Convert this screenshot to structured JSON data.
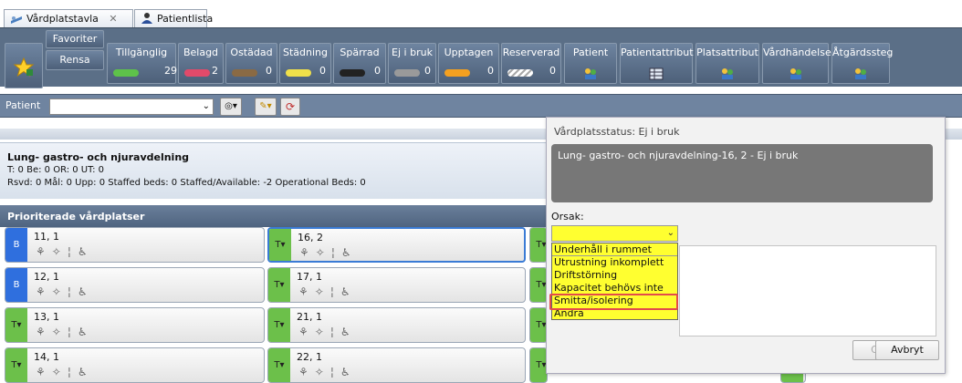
{
  "tabs": [
    {
      "label": "Vårdplatstavla"
    },
    {
      "label": "Patientlista"
    }
  ],
  "toolbar": {
    "favorites_label": "Favoriter",
    "clear_label": "Rensa",
    "status_buttons": [
      {
        "label": "Tillgänglig",
        "count": "29",
        "color": "#5ec24a"
      },
      {
        "label": "Belagd",
        "count": "2",
        "color": "#e24a6a"
      },
      {
        "label": "Ostädad",
        "count": "0",
        "color": "#8a6a44"
      },
      {
        "label": "Städning",
        "count": "0",
        "color": "#f0e04a"
      },
      {
        "label": "Spärrad",
        "count": "0",
        "color": "#222222"
      },
      {
        "label": "Ej i bruk",
        "count": "0",
        "color": "#9a9a9a"
      },
      {
        "label": "Upptagen",
        "count": "0",
        "color": "#f4a020"
      },
      {
        "label": "Reserverad",
        "count": "0",
        "color": "#d8d8d8"
      }
    ],
    "filter_buttons": [
      {
        "label": "Patient",
        "icon": "people-icon"
      },
      {
        "label": "Patientattribut",
        "icon": "grid-icon"
      },
      {
        "label": "Platsattribut",
        "icon": "people-icon"
      },
      {
        "label": "Vårdhändelse",
        "icon": "people-icon"
      },
      {
        "label": "Åtgärdssteg",
        "icon": "people-icon"
      }
    ]
  },
  "patient_bar": {
    "label": "Patient"
  },
  "department": {
    "name": "Lung- gastro- och njuravdelning",
    "line1": "T: 0 Be: 0 OR: 0 UT: 0",
    "line2": "Rsvd: 0 Mål: 0 Upp: 0 Staffed beds: 0 Staffed/Available: -2 Operational Beds: 0"
  },
  "priority_header": "Prioriterade vårdplatser",
  "beds_col1": [
    {
      "name": "11, 1",
      "badge": "B"
    },
    {
      "name": "12, 1",
      "badge": "B"
    },
    {
      "name": "13, 1",
      "badge": "T▾"
    },
    {
      "name": "14, 1",
      "badge": "T▾"
    }
  ],
  "beds_col2": [
    {
      "name": "16, 2",
      "badge": "T▾"
    },
    {
      "name": "17, 1",
      "badge": "T▾"
    },
    {
      "name": "21, 1",
      "badge": "T▾"
    },
    {
      "name": "22, 1",
      "badge": "T▾"
    }
  ],
  "beds_col3_badges": [
    "T▾",
    "T▾",
    "T▾",
    "T▾"
  ],
  "dialog": {
    "title": "Vårdplatsstatus: Ej i bruk",
    "info": "Lung- gastro- och njuravdelning-16, 2 - Ej i bruk",
    "reason_label": "Orsak:",
    "options": [
      "Underhåll i rummet",
      "Utrustning inkomplett",
      "Driftstörning",
      "Kapacitet behövs inte",
      "Smitta/isolering",
      "Andra"
    ],
    "ok_label": "OK",
    "cancel_label": "Avbryt"
  }
}
